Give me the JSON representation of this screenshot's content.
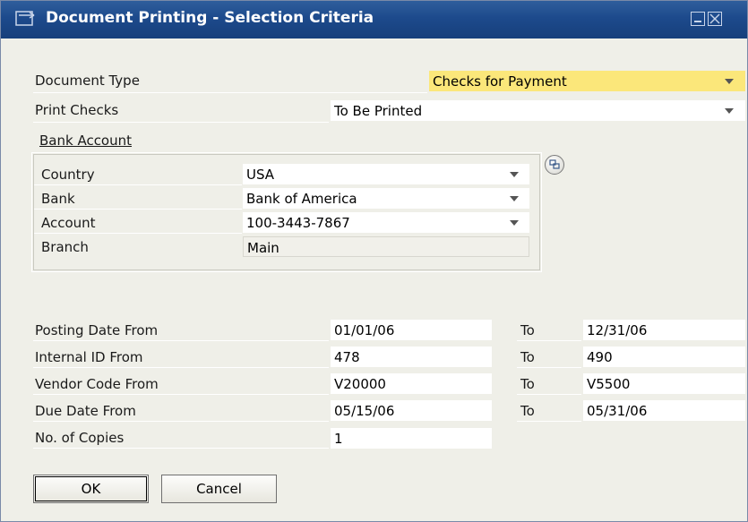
{
  "window": {
    "title": "Document Printing - Selection Criteria"
  },
  "fields": {
    "document_type": {
      "label": "Document Type",
      "value": "Checks for Payment"
    },
    "print_checks": {
      "label": "Print Checks",
      "value": "To Be Printed"
    }
  },
  "bank_account": {
    "label": "Bank Account",
    "country": {
      "label": "Country",
      "value": "USA"
    },
    "bank": {
      "label": "Bank",
      "value": "Bank of America"
    },
    "account": {
      "label": "Account",
      "value": "100-3443-7867"
    },
    "branch": {
      "label": "Branch",
      "value": "Main"
    }
  },
  "ranges": {
    "to_label": "To",
    "posting_date": {
      "label": "Posting Date From",
      "from": "01/01/06",
      "to": "12/31/06"
    },
    "internal_id": {
      "label": "Internal ID From",
      "from": "478",
      "to": "490"
    },
    "vendor_code": {
      "label": "Vendor Code From",
      "from": "V20000",
      "to": "V5500"
    },
    "due_date": {
      "label": "Due Date From",
      "from": "05/15/06",
      "to": "05/31/06"
    },
    "copies": {
      "label": "No. of Copies",
      "value": "1"
    }
  },
  "buttons": {
    "ok": "OK",
    "cancel": "Cancel"
  },
  "colors": {
    "title_bar": "#1d4a8c",
    "highlight_field": "#fbe77a",
    "background": "#efefe8"
  }
}
